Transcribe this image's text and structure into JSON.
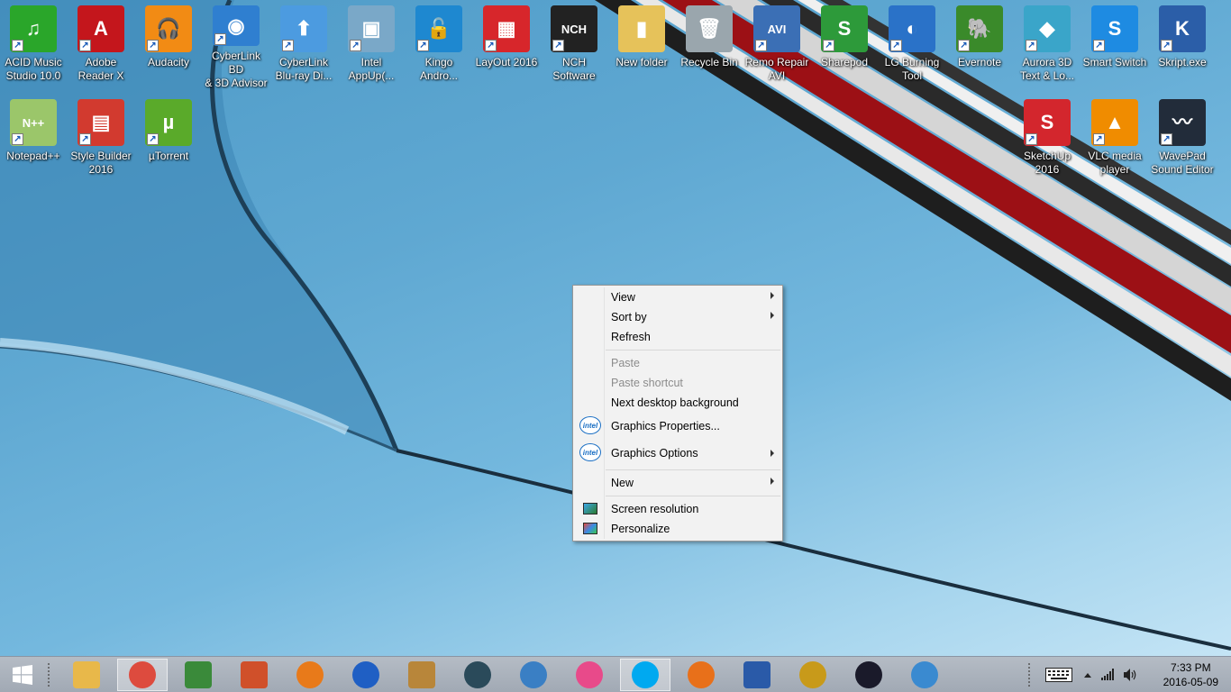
{
  "desktop_icons": [
    {
      "label": "ACID Music\nStudio 10.0",
      "icon": "music-note-icon",
      "color": "#2aa62a",
      "glyph": "♫"
    },
    {
      "label": "Adobe\nReader X",
      "icon": "adobe-reader-icon",
      "color": "#c4161c",
      "glyph": "A"
    },
    {
      "label": "Audacity",
      "icon": "audacity-headphones-icon",
      "color": "#f28b14",
      "glyph": "🎧"
    },
    {
      "label": "CyberLink BD\n& 3D Advisor",
      "icon": "cyberlink-disc-icon",
      "color": "#2f7fd0",
      "glyph": "◉"
    },
    {
      "label": "CyberLink\nBlu-ray Di...",
      "icon": "upload-arrow-icon",
      "color": "#4c9be0",
      "glyph": "⬆"
    },
    {
      "label": "Intel\nAppUp(...",
      "icon": "intel-appup-icon",
      "color": "#7aa8c8",
      "glyph": "▣"
    },
    {
      "label": "Kingo\nAndro...",
      "icon": "kingo-lock-icon",
      "color": "#1e88d0",
      "glyph": "🔓"
    },
    {
      "label": "LayOut 2016",
      "icon": "layout-icon",
      "color": "#d7262b",
      "glyph": "▦"
    },
    {
      "label": "NCH\nSoftware",
      "icon": "nch-icon",
      "color": "#222222",
      "glyph": "NCH"
    },
    {
      "label": "New folder",
      "icon": "folder-icon",
      "color": "#e6c25a",
      "glyph": "▮"
    },
    {
      "label": "Recycle Bin",
      "icon": "recycle-bin-icon",
      "color": "#9aa6ad",
      "glyph": "🗑"
    },
    {
      "label": "Remo Repair\nAVI",
      "icon": "remo-repair-icon",
      "color": "#3b6fb5",
      "glyph": "AVI"
    },
    {
      "label": "Sharepod",
      "icon": "sharepod-icon",
      "color": "#2d9a3a",
      "glyph": "S"
    },
    {
      "label": "LG Burning\nTool",
      "icon": "lg-burning-icon",
      "color": "#2a72c8",
      "glyph": "◐"
    },
    {
      "label": "Evernote",
      "icon": "evernote-icon",
      "color": "#3a8a2a",
      "glyph": "🐘"
    },
    {
      "label": "Aurora 3D\nText & Lo...",
      "icon": "aurora-3d-icon",
      "color": "#3aa5c9",
      "glyph": "◆"
    },
    {
      "label": "Smart Switch",
      "icon": "smart-switch-icon",
      "color": "#1e8be2",
      "glyph": "S"
    },
    {
      "label": "Skript.exe",
      "icon": "skript-icon",
      "color": "#2b5ea8",
      "glyph": "K"
    },
    {
      "label": "Notepad++",
      "icon": "notepad-plus-icon",
      "color": "#9bc66a",
      "glyph": "N++"
    },
    {
      "label": "Style Builder\n2016",
      "icon": "style-builder-icon",
      "color": "#d23a2f",
      "glyph": "▤"
    },
    {
      "label": "µTorrent",
      "icon": "utorrent-icon",
      "color": "#5aaa2a",
      "glyph": "µ"
    },
    {
      "label": "SketchUp\n2016",
      "icon": "sketchup-icon",
      "color": "#d3262d",
      "glyph": "S"
    },
    {
      "label": "VLC media\nplayer",
      "icon": "vlc-cone-icon",
      "color": "#f08c00",
      "glyph": "▲"
    },
    {
      "label": "WavePad\nSound Editor",
      "icon": "wavepad-icon",
      "color": "#222c3a",
      "glyph": "〰"
    }
  ],
  "context_menu": {
    "items": [
      {
        "label": "View",
        "submenu": true,
        "disabled": false
      },
      {
        "label": "Sort by",
        "submenu": true,
        "disabled": false
      },
      {
        "label": "Refresh",
        "submenu": false,
        "disabled": false
      },
      {
        "label": "Paste",
        "submenu": false,
        "disabled": true
      },
      {
        "label": "Paste shortcut",
        "submenu": false,
        "disabled": true
      },
      {
        "label": "Next desktop background",
        "submenu": false,
        "disabled": false
      },
      {
        "label": "Graphics Properties...",
        "submenu": false,
        "disabled": false,
        "icon": "intel-icon"
      },
      {
        "label": "Graphics Options",
        "submenu": true,
        "disabled": false,
        "icon": "intel-icon"
      },
      {
        "label": "New",
        "submenu": true,
        "disabled": false
      },
      {
        "label": "Screen resolution",
        "submenu": false,
        "disabled": false,
        "icon": "monitor-icon"
      },
      {
        "label": "Personalize",
        "submenu": false,
        "disabled": false,
        "icon": "personalize-icon"
      }
    ],
    "intel_text": "intel"
  },
  "taskbar": {
    "start_icon": "windows-logo-icon",
    "apps": [
      {
        "icon": "file-explorer-icon",
        "color": "#e8b84a",
        "active": false
      },
      {
        "icon": "chrome-icon",
        "color": "#dd4b3e",
        "active": true
      },
      {
        "icon": "wondershare-icon",
        "color": "#3a8a3a",
        "active": false
      },
      {
        "icon": "office-tiles-icon",
        "color": "#d0502a",
        "active": false
      },
      {
        "icon": "media-player-icon",
        "color": "#e87a1a",
        "active": false
      },
      {
        "icon": "malwarebytes-icon",
        "color": "#1f5fc4",
        "active": false
      },
      {
        "icon": "bank-building-icon",
        "color": "#b8863a",
        "active": false
      },
      {
        "icon": "film-reel-icon",
        "color": "#2a4a5a",
        "active": false
      },
      {
        "icon": "bird-app-icon",
        "color": "#3a7fc4",
        "active": false
      },
      {
        "icon": "itunes-icon",
        "color": "#e84a8a",
        "active": false
      },
      {
        "icon": "skype-icon",
        "color": "#00a9f0",
        "active": true
      },
      {
        "icon": "firefox-icon",
        "color": "#e8701a",
        "active": false
      },
      {
        "icon": "remote-desktop-icon",
        "color": "#2a5aa8",
        "active": false
      },
      {
        "icon": "hypercam-icon",
        "color": "#c89a1a",
        "active": false
      },
      {
        "icon": "play-circle-icon",
        "color": "#1a1a2a",
        "active": false
      },
      {
        "icon": "safari-compass-icon",
        "color": "#3a8ad0",
        "active": false
      }
    ],
    "tray_icons": [
      "keyboard-icon",
      "chevron-up-icon",
      "signal-bars-icon",
      "speaker-icon"
    ],
    "time": "7:33 PM",
    "date": "2016-05-09"
  }
}
